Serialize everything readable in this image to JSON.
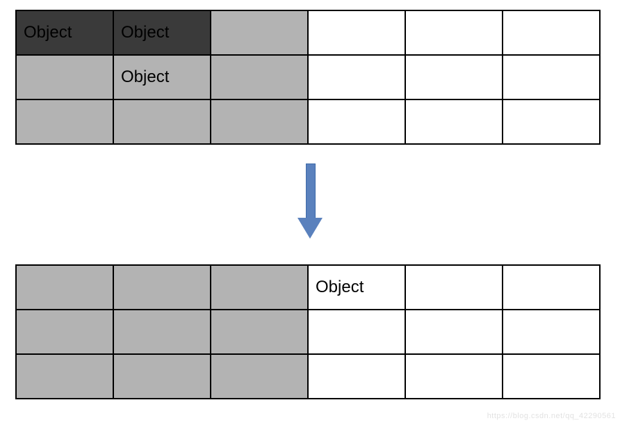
{
  "diagram": {
    "label_object": "Object",
    "colors": {
      "gray": "#b3b3b3",
      "dark": "#3a3a3a",
      "white": "#ffffff",
      "arrow": "#5a81bd",
      "border": "#000000"
    },
    "grids": {
      "rows": 3,
      "cols": 6,
      "top": {
        "cells": [
          [
            {
              "fill": "dark",
              "text": "Object"
            },
            {
              "fill": "dark",
              "text": "Object"
            },
            {
              "fill": "gray",
              "text": ""
            },
            {
              "fill": "white",
              "text": ""
            },
            {
              "fill": "white",
              "text": ""
            },
            {
              "fill": "white",
              "text": ""
            }
          ],
          [
            {
              "fill": "gray",
              "text": ""
            },
            {
              "fill": "gray",
              "text": "Object"
            },
            {
              "fill": "gray",
              "text": ""
            },
            {
              "fill": "white",
              "text": ""
            },
            {
              "fill": "white",
              "text": ""
            },
            {
              "fill": "white",
              "text": ""
            }
          ],
          [
            {
              "fill": "gray",
              "text": ""
            },
            {
              "fill": "gray",
              "text": ""
            },
            {
              "fill": "gray",
              "text": ""
            },
            {
              "fill": "white",
              "text": ""
            },
            {
              "fill": "white",
              "text": ""
            },
            {
              "fill": "white",
              "text": ""
            }
          ]
        ]
      },
      "bottom": {
        "cells": [
          [
            {
              "fill": "gray",
              "text": ""
            },
            {
              "fill": "gray",
              "text": ""
            },
            {
              "fill": "gray",
              "text": ""
            },
            {
              "fill": "white",
              "text": "Object"
            },
            {
              "fill": "white",
              "text": ""
            },
            {
              "fill": "white",
              "text": ""
            }
          ],
          [
            {
              "fill": "gray",
              "text": ""
            },
            {
              "fill": "gray",
              "text": ""
            },
            {
              "fill": "gray",
              "text": ""
            },
            {
              "fill": "white",
              "text": ""
            },
            {
              "fill": "white",
              "text": ""
            },
            {
              "fill": "white",
              "text": ""
            }
          ],
          [
            {
              "fill": "gray",
              "text": ""
            },
            {
              "fill": "gray",
              "text": ""
            },
            {
              "fill": "gray",
              "text": ""
            },
            {
              "fill": "white",
              "text": ""
            },
            {
              "fill": "white",
              "text": ""
            },
            {
              "fill": "white",
              "text": ""
            }
          ]
        ]
      }
    },
    "watermark": "https://blog.csdn.net/qq_42290561"
  }
}
